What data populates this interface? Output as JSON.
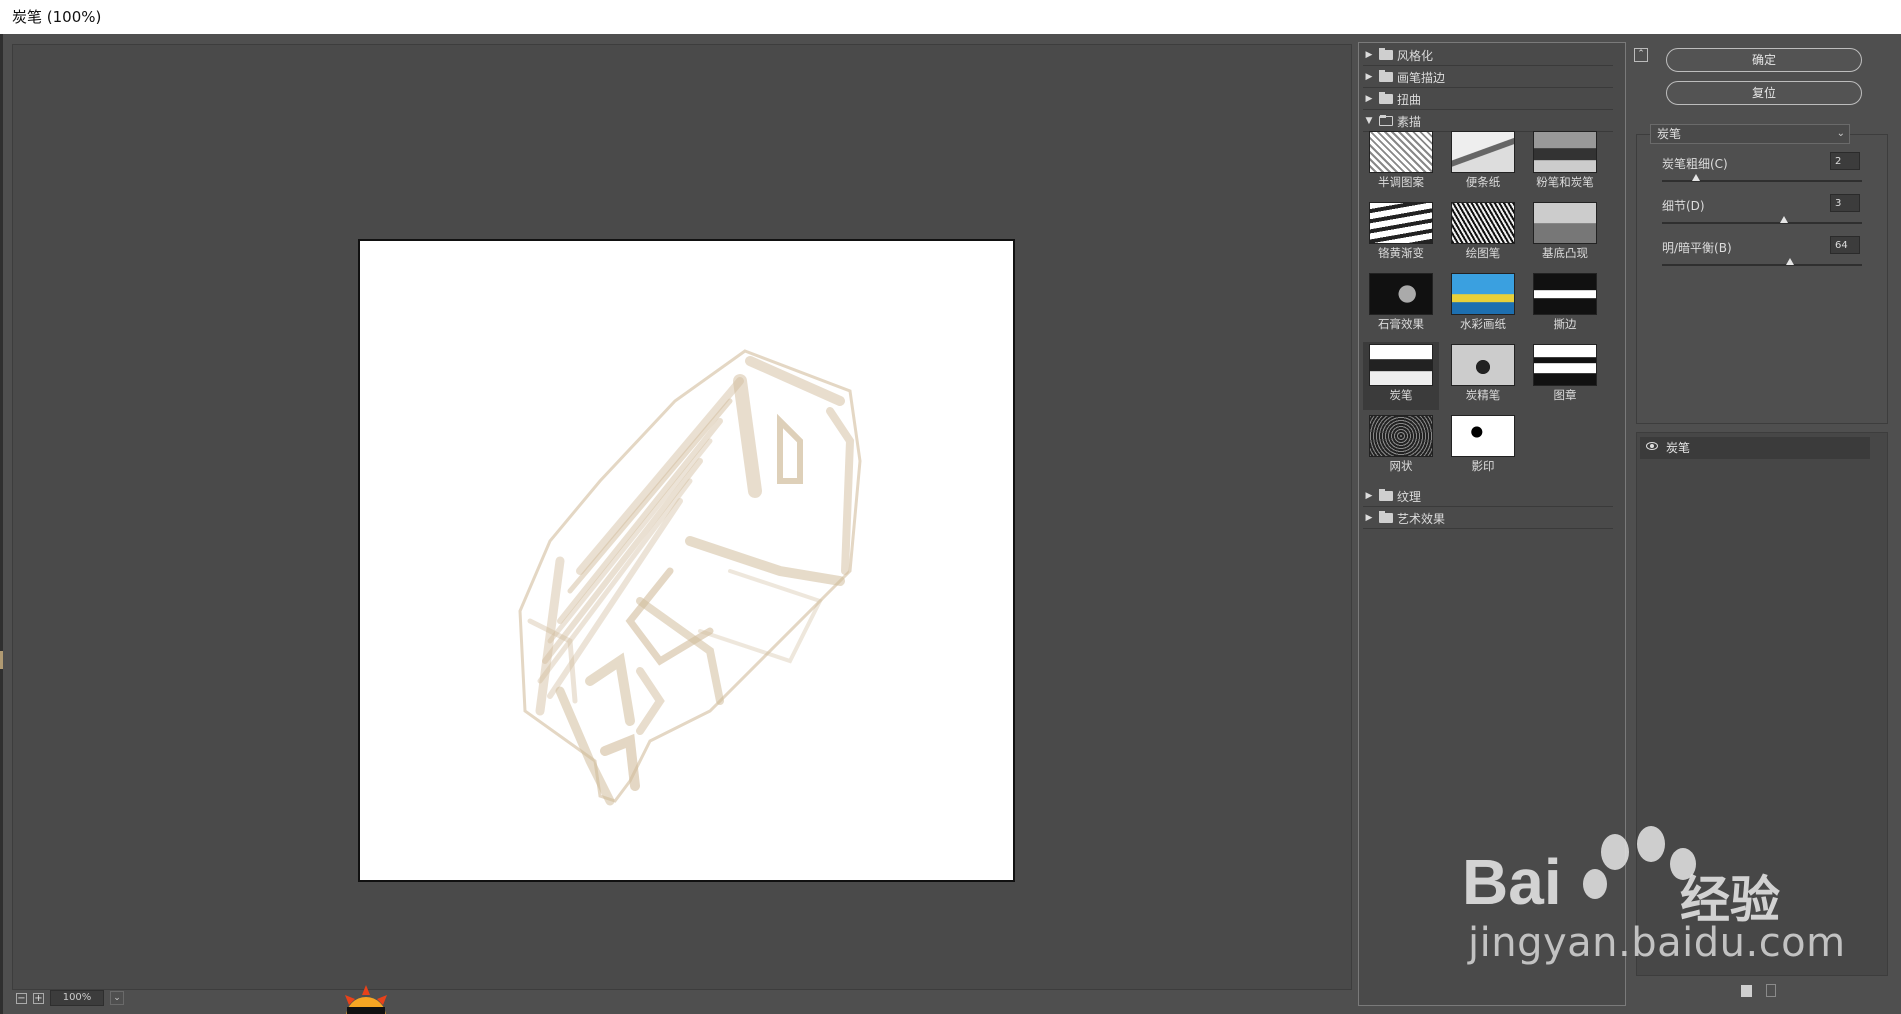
{
  "window": {
    "title": "炭笔 (100%)"
  },
  "zoom": {
    "minus": "−",
    "plus": "+",
    "value": "100%",
    "dropdown": "⌄"
  },
  "gallery": {
    "folders_top": [
      {
        "label": "风格化",
        "expanded": false
      },
      {
        "label": "画笔描边",
        "expanded": false
      },
      {
        "label": "扭曲",
        "expanded": false
      },
      {
        "label": "素描",
        "expanded": true
      }
    ],
    "thumbnails": [
      {
        "label": "半调图案"
      },
      {
        "label": "便条纸"
      },
      {
        "label": "粉笔和炭笔"
      },
      {
        "label": "铬黄渐变"
      },
      {
        "label": "绘图笔"
      },
      {
        "label": "基底凸现"
      },
      {
        "label": "石膏效果"
      },
      {
        "label": "水彩画纸"
      },
      {
        "label": "撕边"
      },
      {
        "label": "炭笔"
      },
      {
        "label": "炭精笔"
      },
      {
        "label": "图章"
      },
      {
        "label": "网状"
      },
      {
        "label": "影印"
      }
    ],
    "selected_thumbnail": "炭笔",
    "folders_bottom": [
      {
        "label": "纹理",
        "expanded": false
      },
      {
        "label": "艺术效果",
        "expanded": false
      }
    ]
  },
  "buttons": {
    "ok": "确定",
    "reset": "复位"
  },
  "filter_select": {
    "value": "炭笔"
  },
  "params": [
    {
      "label": "炭笔粗细(C)",
      "value": "2",
      "fraction": 0.14
    },
    {
      "label": "细节(D)",
      "value": "3",
      "fraction": 0.6
    },
    {
      "label": "明/暗平衡(B)",
      "value": "64",
      "fraction": 0.64
    }
  ],
  "layers": [
    {
      "label": "炭笔",
      "visible": true
    }
  ],
  "watermark": {
    "brand": "Bai",
    "brand_cn": "经验",
    "url": "jingyan.baidu.com"
  },
  "colors": {
    "accent_sketch": "#c9b08a",
    "bg": "#4f4f4f"
  }
}
